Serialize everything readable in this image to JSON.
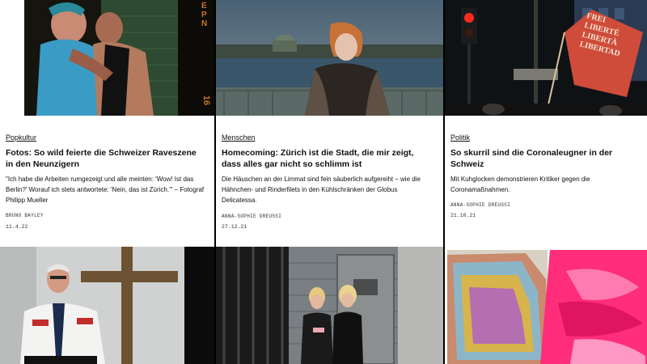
{
  "articles": [
    {
      "category": "Popkultur",
      "title": "Fotos: So wild feierte die Schweizer Raveszene in den Neunzigern",
      "lede": "\"Ich habe die Arbeiten rumgezeigt und alle meinten: 'Wow! Ist das Berlin?' Worauf ich stets antwortete: 'Nein, das ist Zürich.'\" – Fotograf Philipp Mueller",
      "author": "BRUNO BAYLEY",
      "date": "11.4.22",
      "image_text": "EPN",
      "image_number": "16"
    },
    {
      "category": "Menschen",
      "title": "Homecoming: Zürich ist die Stadt, die mir zeigt, dass alles gar nicht so schlimm ist",
      "lede": "Die Häuschen an der Limmat sind fein säuberlich aufgereiht – wie die Hähnchen- und Rinderfilets in den Kühlschränken der Globus Delicatessa.",
      "author": "ANNA-SOPHIE DREUSSI",
      "date": "27.12.21"
    },
    {
      "category": "Politik",
      "title": "So skurril sind die Coronaleugner in der Schweiz",
      "lede": "Mit Kuhglocken demonstrieren Kritiker gegen die Coronamaßnahmen.",
      "author": "ANNA-SOPHIE DREUSSI",
      "date": "21.10.21",
      "flag_text": [
        "FREI",
        "LIBERTÉ",
        "LIBERTÀ",
        "LIBERTAD"
      ]
    }
  ],
  "colors": {
    "card_bg": "#ffffff",
    "gutter": "#000000",
    "accent_pink": "#ff2d7a"
  }
}
